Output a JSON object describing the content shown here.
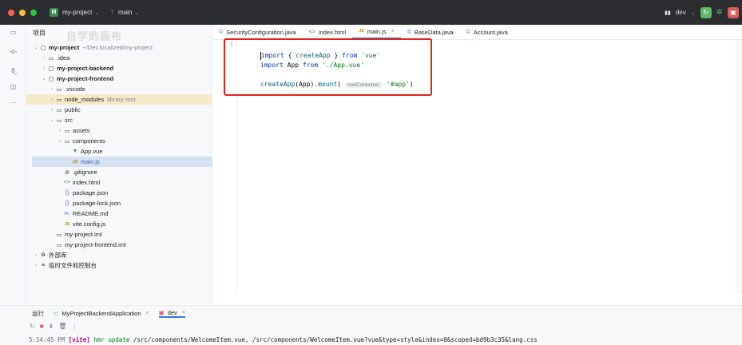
{
  "titlebar": {
    "project_badge": "M",
    "project_name": "my-project",
    "branch": "main",
    "run_config": "dev",
    "colors": {
      "close": "#ff5f57",
      "minimize": "#febc2e",
      "maximize": "#28c840"
    },
    "icons": [
      "branch-icon",
      "run-icon",
      "debug-icon",
      "stop-icon"
    ]
  },
  "project_panel": {
    "title": "项目",
    "watermark": "自学的画布",
    "tree": [
      {
        "label": "my-project",
        "suffix": "~/Dev.localized/my-project",
        "arrow": "⌄",
        "icon": "▢",
        "bold": true
      },
      {
        "label": ".idea",
        "arrow": "›",
        "icon": "▭"
      },
      {
        "label": "my-project-backend",
        "arrow": "›",
        "icon": "▢",
        "bold": true
      },
      {
        "label": "my-project-frontend",
        "arrow": "⌄",
        "icon": "▢",
        "bold": true
      },
      {
        "label": ".vscode",
        "arrow": "›",
        "icon": "▭"
      },
      {
        "label": "node_modules",
        "suffix": "library root",
        "arrow": "›",
        "icon": "▭"
      },
      {
        "label": "public",
        "arrow": "›",
        "icon": "▭"
      },
      {
        "label": "src",
        "arrow": "⌄",
        "icon": "▭"
      },
      {
        "label": "assets",
        "arrow": "›",
        "icon": "▭"
      },
      {
        "label": "components",
        "arrow": "⌄",
        "icon": "▭"
      },
      {
        "label": "App.vue",
        "arrow": "",
        "icon": "▼"
      },
      {
        "label": "main.js",
        "arrow": "",
        "icon": "JS"
      },
      {
        "label": ".gitignore",
        "arrow": "",
        "icon": "⊘"
      },
      {
        "label": "index.html",
        "arrow": "",
        "icon": "<>"
      },
      {
        "label": "package.json",
        "arrow": "",
        "icon": "{}"
      },
      {
        "label": "package-lock.json",
        "arrow": "",
        "icon": "{}"
      },
      {
        "label": "README.md",
        "arrow": "",
        "icon": "M↓"
      },
      {
        "label": "vite.config.js",
        "arrow": "",
        "icon": "JS"
      },
      {
        "label": "my-project.iml",
        "arrow": "",
        "icon": "▭"
      },
      {
        "label": "my-project-frontend.iml",
        "arrow": "",
        "icon": "▭"
      },
      {
        "label": "外部库",
        "arrow": "›",
        "icon": "ılı"
      },
      {
        "label": "临时文件和控制台",
        "arrow": "›",
        "icon": "≡"
      }
    ]
  },
  "editor": {
    "tabs": [
      {
        "label": "SecurityConfiguration.java",
        "icon": "©"
      },
      {
        "label": "index.html",
        "icon": "<>"
      },
      {
        "label": "main.js",
        "icon": "JS",
        "close": "×"
      },
      {
        "label": "BaseData.java",
        "icon": "©"
      },
      {
        "label": "Account.java",
        "icon": "©"
      }
    ],
    "line_numbers": [
      "1"
    ],
    "code": {
      "line1": {
        "kw1": "import",
        "p1": " { ",
        "fn1": "createApp",
        "p2": " } ",
        "kw2": "from",
        "sp": " ",
        "str1": "'vue'"
      },
      "line2": {
        "kw1": "import",
        "p1": " App ",
        "kw2": "from",
        "sp": " ",
        "str1": "'./App.vue'"
      },
      "line3": {
        "fn1": "createApp",
        "p1": "(App).",
        "fn2": "mount",
        "p2": "( ",
        "hint": "rootContainer:",
        "sp": " ",
        "str1": "'#app'",
        "p3": ")"
      }
    }
  },
  "bottom": {
    "run_label": "运行",
    "tabs": [
      {
        "label": "MyProjectBackendApplication",
        "close": "×"
      },
      {
        "label": "dev",
        "close": "×"
      }
    ],
    "console_line": {
      "time": "5:54:45 PM",
      "tag": "[vite]",
      "action": "hmr update",
      "text": "/src/components/WelcomeItem.vue, /src/components/WelcomeItem.vue?vue&type=style&index=0&scoped=bd9b3c35&lang.css"
    }
  }
}
